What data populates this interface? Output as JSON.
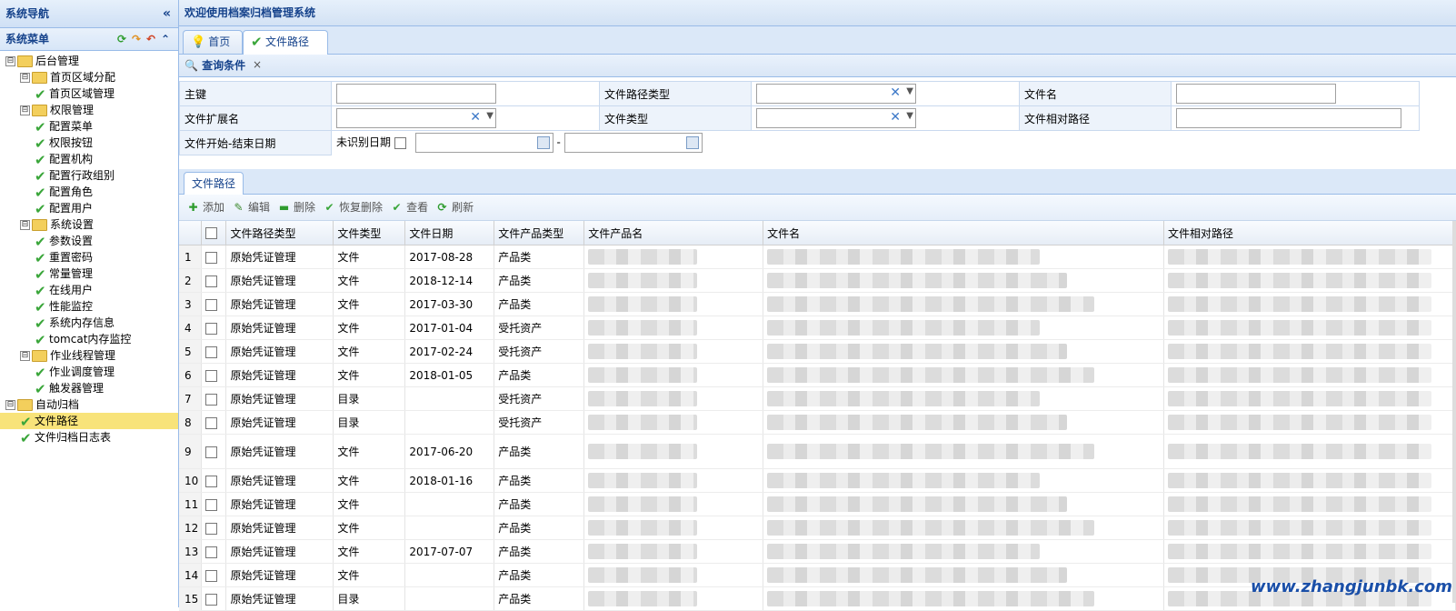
{
  "nav": {
    "header": "系统导航",
    "collapse_icon": "double-chevron-left-icon",
    "menu_title": "系统菜单",
    "tree": [
      {
        "label": "后台管理",
        "level": 0,
        "type": "folder",
        "toggle": "⊟"
      },
      {
        "label": "首页区域分配",
        "level": 1,
        "type": "folder",
        "toggle": "⊟"
      },
      {
        "label": "首页区域管理",
        "level": 2,
        "type": "leaf"
      },
      {
        "label": "权限管理",
        "level": 1,
        "type": "folder",
        "toggle": "⊟"
      },
      {
        "label": "配置菜单",
        "level": 2,
        "type": "leaf"
      },
      {
        "label": "权限按钮",
        "level": 2,
        "type": "leaf"
      },
      {
        "label": "配置机构",
        "level": 2,
        "type": "leaf"
      },
      {
        "label": "配置行政组别",
        "level": 2,
        "type": "leaf"
      },
      {
        "label": "配置角色",
        "level": 2,
        "type": "leaf"
      },
      {
        "label": "配置用户",
        "level": 2,
        "type": "leaf"
      },
      {
        "label": "系统设置",
        "level": 1,
        "type": "folder",
        "toggle": "⊟"
      },
      {
        "label": "参数设置",
        "level": 2,
        "type": "leaf"
      },
      {
        "label": "重置密码",
        "level": 2,
        "type": "leaf"
      },
      {
        "label": "常量管理",
        "level": 2,
        "type": "leaf"
      },
      {
        "label": "在线用户",
        "level": 2,
        "type": "leaf"
      },
      {
        "label": "性能监控",
        "level": 2,
        "type": "leaf"
      },
      {
        "label": "系统内存信息",
        "level": 2,
        "type": "leaf"
      },
      {
        "label": "tomcat内存监控",
        "level": 2,
        "type": "leaf"
      },
      {
        "label": "作业线程管理",
        "level": 1,
        "type": "folder",
        "toggle": "⊟"
      },
      {
        "label": "作业调度管理",
        "level": 2,
        "type": "leaf"
      },
      {
        "label": "触发器管理",
        "level": 2,
        "type": "leaf"
      },
      {
        "label": "自动归档",
        "level": 0,
        "type": "folder",
        "toggle": "⊟"
      },
      {
        "label": "文件路径",
        "level": 1,
        "type": "leaf",
        "selected": true
      },
      {
        "label": "文件归档日志表",
        "level": 1,
        "type": "leaf"
      }
    ]
  },
  "app_title": "欢迎使用档案归档管理系统",
  "tabs": [
    {
      "label": "首页",
      "icon": "bulb-icon"
    },
    {
      "label": "文件路径",
      "icon": "check-icon",
      "close": "×"
    }
  ],
  "query": {
    "title": "查询条件",
    "fields": {
      "key_label": "主键",
      "path_type_label": "文件路径类型",
      "file_name_label": "文件名",
      "ext_label": "文件扩展名",
      "file_type_label": "文件类型",
      "rel_path_label": "文件相对路径",
      "date_label": "文件开始-结束日期",
      "unknown_date_label": "未识别日期",
      "date_sep": "-"
    }
  },
  "grid": {
    "tab": "文件路径",
    "toolbar": [
      {
        "label": "添加",
        "icon": "add-icon",
        "glyph": "✚",
        "color": "#2e9c2e"
      },
      {
        "label": "编辑",
        "icon": "pencil-icon",
        "glyph": "✎",
        "color": "#3d8a2e"
      },
      {
        "label": "删除",
        "icon": "remove-icon",
        "glyph": "▬",
        "color": "#2e9c2e"
      },
      {
        "label": "恢复删除",
        "icon": "check-icon",
        "glyph": "✔",
        "color": "#3aa63a"
      },
      {
        "label": "查看",
        "icon": "check-icon",
        "glyph": "✔",
        "color": "#3aa63a"
      },
      {
        "label": "刷新",
        "icon": "refresh-icon",
        "glyph": "⟳",
        "color": "#2e9c2e"
      }
    ],
    "columns": [
      "文件路径类型",
      "文件类型",
      "文件日期",
      "文件产品类型",
      "文件产品名",
      "文件名",
      "文件相对路径"
    ],
    "rows": [
      {
        "n": "1",
        "path_type": "原始凭证管理",
        "file_type": "文件",
        "date": "2017-08-28",
        "product_type": "产品类"
      },
      {
        "n": "2",
        "path_type": "原始凭证管理",
        "file_type": "文件",
        "date": "2018-12-14",
        "product_type": "产品类"
      },
      {
        "n": "3",
        "path_type": "原始凭证管理",
        "file_type": "文件",
        "date": "2017-03-30",
        "product_type": "产品类"
      },
      {
        "n": "4",
        "path_type": "原始凭证管理",
        "file_type": "文件",
        "date": "2017-01-04",
        "product_type": "受托资产"
      },
      {
        "n": "5",
        "path_type": "原始凭证管理",
        "file_type": "文件",
        "date": "2017-02-24",
        "product_type": "受托资产"
      },
      {
        "n": "6",
        "path_type": "原始凭证管理",
        "file_type": "文件",
        "date": "2018-01-05",
        "product_type": "产品类"
      },
      {
        "n": "7",
        "path_type": "原始凭证管理",
        "file_type": "目录",
        "date": "",
        "product_type": "受托资产"
      },
      {
        "n": "8",
        "path_type": "原始凭证管理",
        "file_type": "目录",
        "date": "",
        "product_type": "受托资产"
      },
      {
        "n": "9",
        "path_type": "原始凭证管理",
        "file_type": "文件",
        "date": "2017-06-20",
        "product_type": "产品类",
        "tall": true
      },
      {
        "n": "10",
        "path_type": "原始凭证管理",
        "file_type": "文件",
        "date": "2018-01-16",
        "product_type": "产品类"
      },
      {
        "n": "11",
        "path_type": "原始凭证管理",
        "file_type": "文件",
        "date": "",
        "product_type": "产品类"
      },
      {
        "n": "12",
        "path_type": "原始凭证管理",
        "file_type": "文件",
        "date": "",
        "product_type": "产品类"
      },
      {
        "n": "13",
        "path_type": "原始凭证管理",
        "file_type": "文件",
        "date": "2017-07-07",
        "product_type": "产品类"
      },
      {
        "n": "14",
        "path_type": "原始凭证管理",
        "file_type": "文件",
        "date": "",
        "product_type": "产品类"
      },
      {
        "n": "15",
        "path_type": "原始凭证管理",
        "file_type": "目录",
        "date": "",
        "product_type": "产品类"
      }
    ]
  },
  "watermark": "www.zhangjunbk.com"
}
